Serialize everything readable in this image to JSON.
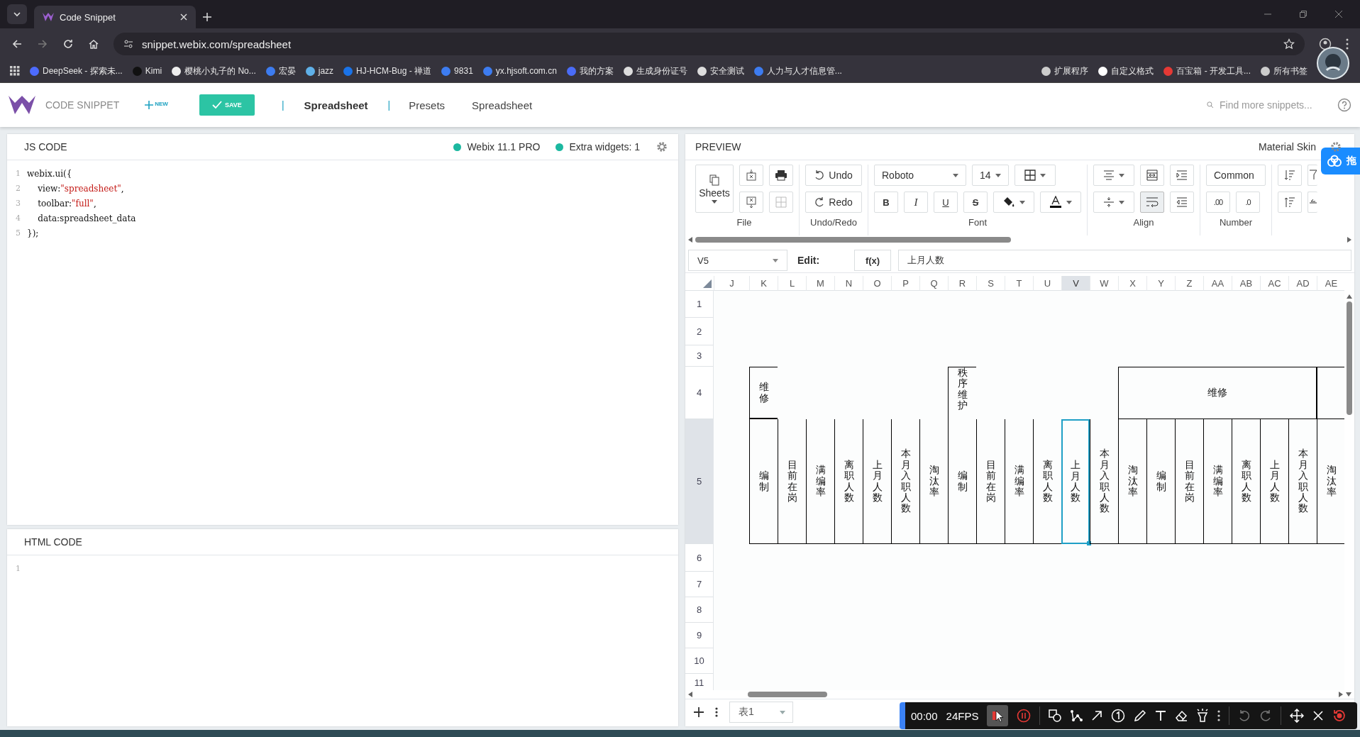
{
  "browser": {
    "tab_title": "Code Snippet",
    "url": "snippet.webix.com/spreadsheet",
    "bookmarks": [
      {
        "label": "DeepSeek - 探索未..."
      },
      {
        "label": "Kimi"
      },
      {
        "label": "樱桃小丸子的 No..."
      },
      {
        "label": "宏晏"
      },
      {
        "label": "jazz"
      },
      {
        "label": "HJ-HCM-Bug - 禅道"
      },
      {
        "label": "9831"
      },
      {
        "label": "yx.hjsoft.com.cn"
      },
      {
        "label": "我的方案"
      },
      {
        "label": "生成身份证号"
      },
      {
        "label": "安全测试"
      },
      {
        "label": "人力与人才信息管..."
      }
    ],
    "bookmarks_right": [
      {
        "label": "扩展程序"
      },
      {
        "label": "自定义格式"
      },
      {
        "label": "百宝箱 - 开发工具..."
      }
    ],
    "all_bookmarks": "所有书签"
  },
  "header": {
    "brand": "CODE SNIPPET",
    "new_label": "NEW",
    "save_label": "SAVE",
    "separators": [
      "|",
      "|"
    ],
    "nav": [
      {
        "label": "Spreadsheet",
        "selected": true
      },
      {
        "label": "Presets",
        "selected": false
      },
      {
        "label": "Spreadsheet",
        "selected": false
      }
    ],
    "search_placeholder": "Find more snippets..."
  },
  "js_panel": {
    "title": "JS CODE",
    "version": "Webix 11.1 PRO",
    "extras": "Extra widgets: 1",
    "lines": [
      {
        "number": "1",
        "segments": [
          {
            "text": "webix.ui({",
            "kind": "plain"
          }
        ]
      },
      {
        "number": "2",
        "segments": [
          {
            "text": "    view:",
            "kind": "plain"
          },
          {
            "text": "\"spreadsheet\"",
            "kind": "string"
          },
          {
            "text": ",",
            "kind": "plain"
          }
        ]
      },
      {
        "number": "3",
        "segments": [
          {
            "text": "    toolbar:",
            "kind": "plain"
          },
          {
            "text": "\"full\"",
            "kind": "string"
          },
          {
            "text": ",",
            "kind": "plain"
          }
        ]
      },
      {
        "number": "4",
        "segments": [
          {
            "text": "    data:spreadsheet_data",
            "kind": "plain"
          }
        ]
      },
      {
        "number": "5",
        "segments": [
          {
            "text": "});",
            "kind": "plain"
          }
        ]
      }
    ]
  },
  "html_panel": {
    "title": "HTML CODE",
    "line_numbers": [
      "1"
    ]
  },
  "preview": {
    "title": "PREVIEW",
    "skin": "Material Skin",
    "toolbar": {
      "sheets": "Sheets",
      "undo": "Undo",
      "redo": "Redo",
      "font": "Roboto",
      "size": "14",
      "bold": "B",
      "italic": "I",
      "underline": "U",
      "strike": "S",
      "format": "Common",
      "increase_decimals": ".00",
      "decrease_decimals": ".0",
      "groups": [
        "File",
        "Undo/Redo",
        "Font",
        "Align",
        "Number"
      ]
    },
    "formula": {
      "cell": "V5",
      "edit_label": "Edit:",
      "fx": "f(x)",
      "value": "上月人数"
    },
    "sheet": {
      "columns": [
        {
          "label": "J",
          "selected": false
        },
        {
          "label": "K",
          "selected": false
        },
        {
          "label": "L",
          "selected": false
        },
        {
          "label": "M",
          "selected": false
        },
        {
          "label": "N",
          "selected": false
        },
        {
          "label": "O",
          "selected": false
        },
        {
          "label": "P",
          "selected": false
        },
        {
          "label": "Q",
          "selected": false
        },
        {
          "label": "R",
          "selected": false
        },
        {
          "label": "S",
          "selected": false
        },
        {
          "label": "T",
          "selected": false
        },
        {
          "label": "U",
          "selected": false
        },
        {
          "label": "V",
          "selected": true
        },
        {
          "label": "W",
          "selected": false
        },
        {
          "label": "X",
          "selected": false
        },
        {
          "label": "Y",
          "selected": false
        },
        {
          "label": "Z",
          "selected": false
        },
        {
          "label": "AA",
          "selected": false
        },
        {
          "label": "AB",
          "selected": false
        },
        {
          "label": "AC",
          "selected": false
        },
        {
          "label": "AD",
          "selected": false
        },
        {
          "label": "AE",
          "selected": false
        }
      ],
      "rows": [
        {
          "label": "1",
          "selected": false
        },
        {
          "label": "2",
          "selected": false
        },
        {
          "label": "3",
          "selected": false
        },
        {
          "label": "4",
          "selected": false
        },
        {
          "label": "5",
          "selected": true
        },
        {
          "label": "6",
          "selected": false
        },
        {
          "label": "7",
          "selected": false
        },
        {
          "label": "8",
          "selected": false
        },
        {
          "label": "9",
          "selected": false
        },
        {
          "label": "10",
          "selected": false
        },
        {
          "label": "11",
          "selected": false
        }
      ],
      "row_4_cells": [
        "维修",
        "秩序维护",
        "维修"
      ],
      "row_5_cells": [
        {
          "text": "编制",
          "selected": false
        },
        {
          "text": "目前在岗",
          "selected": false
        },
        {
          "text": "满编率",
          "selected": false
        },
        {
          "text": "离职人数",
          "selected": false
        },
        {
          "text": "上月人数",
          "selected": false
        },
        {
          "text": "本月入职人数",
          "selected": false
        },
        {
          "text": "淘汰率",
          "selected": false
        },
        {
          "text": "编制",
          "selected": false
        },
        {
          "text": "目前在岗",
          "selected": false
        },
        {
          "text": "满编率",
          "selected": false
        },
        {
          "text": "离职人数",
          "selected": false
        },
        {
          "text": "上月人数",
          "selected": true
        },
        {
          "text": "本月入职人数",
          "selected": false
        },
        {
          "text": "淘汰率",
          "selected": false
        },
        {
          "text": "编制",
          "selected": false
        },
        {
          "text": "目前在岗",
          "selected": false
        },
        {
          "text": "满编率",
          "selected": false
        },
        {
          "text": "离职人数",
          "selected": false
        },
        {
          "text": "上月人数",
          "selected": false
        },
        {
          "text": "本月入职人数",
          "selected": false
        },
        {
          "text": "淘汰率",
          "selected": false
        }
      ]
    },
    "sheet_tab": "表1"
  },
  "float_badge": "拖",
  "recorder": {
    "time": "00:00",
    "fps": "24FPS"
  }
}
